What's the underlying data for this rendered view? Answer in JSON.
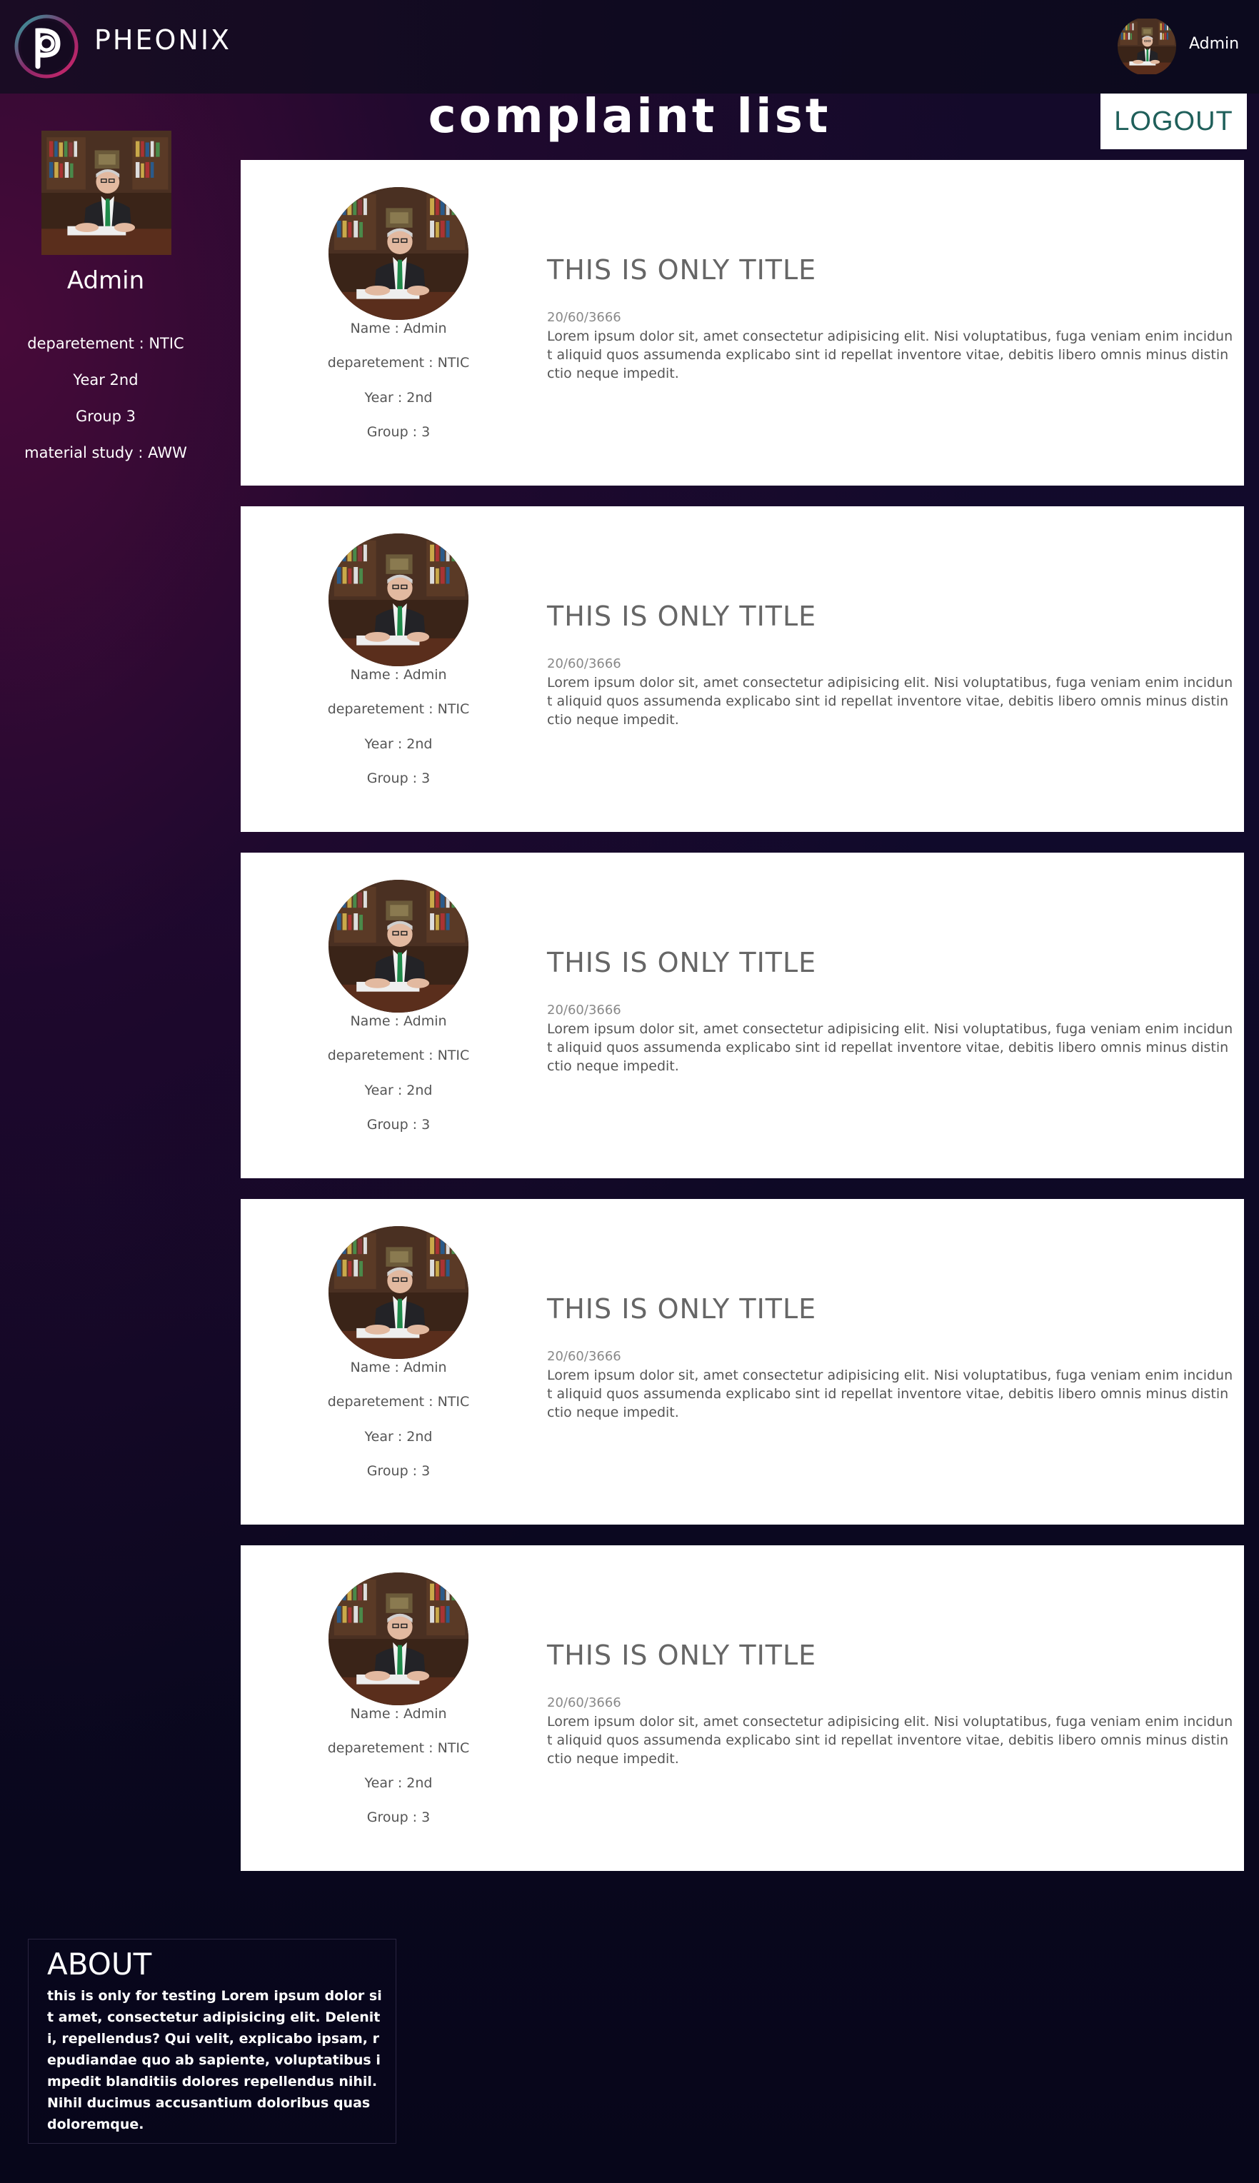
{
  "header": {
    "brand": "PHEONIX",
    "user_name": "Admin",
    "logout_label": "LOGOUT"
  },
  "page_title": "complaint list",
  "sidebar": {
    "name": "Admin",
    "lines": [
      "deparetement : NTIC",
      "Year 2nd",
      "Group 3",
      "material study : AWW"
    ]
  },
  "complaints": [
    {
      "name": "Name : Admin",
      "department": "deparetement : NTIC",
      "year": "Year : 2nd",
      "group": "Group : 3",
      "title": "THIS IS ONLY TITLE",
      "date": "20/60/3666",
      "body": "Lorem ipsum dolor sit, amet consectetur adipisicing elit. Nisi voluptatibus, fuga veniam enim incidunt aliquid quos assumenda explicabo sint id repellat inventore vitae, debitis libero omnis minus distinctio neque impedit."
    },
    {
      "name": "Name : Admin",
      "department": "deparetement : NTIC",
      "year": "Year : 2nd",
      "group": "Group : 3",
      "title": "THIS IS ONLY TITLE",
      "date": "20/60/3666",
      "body": "Lorem ipsum dolor sit, amet consectetur adipisicing elit. Nisi voluptatibus, fuga veniam enim incidunt aliquid quos assumenda explicabo sint id repellat inventore vitae, debitis libero omnis minus distinctio neque impedit."
    },
    {
      "name": "Name : Admin",
      "department": "deparetement : NTIC",
      "year": "Year : 2nd",
      "group": "Group : 3",
      "title": "THIS IS ONLY TITLE",
      "date": "20/60/3666",
      "body": "Lorem ipsum dolor sit, amet consectetur adipisicing elit. Nisi voluptatibus, fuga veniam enim incidunt aliquid quos assumenda explicabo sint id repellat inventore vitae, debitis libero omnis minus distinctio neque impedit."
    },
    {
      "name": "Name : Admin",
      "department": "deparetement : NTIC",
      "year": "Year : 2nd",
      "group": "Group : 3",
      "title": "THIS IS ONLY TITLE",
      "date": "20/60/3666",
      "body": "Lorem ipsum dolor sit, amet consectetur adipisicing elit. Nisi voluptatibus, fuga veniam enim incidunt aliquid quos assumenda explicabo sint id repellat inventore vitae, debitis libero omnis minus distinctio neque impedit."
    },
    {
      "name": "Name : Admin",
      "department": "deparetement : NTIC",
      "year": "Year : 2nd",
      "group": "Group : 3",
      "title": "THIS IS ONLY TITLE",
      "date": "20/60/3666",
      "body": "Lorem ipsum dolor sit, amet consectetur adipisicing elit. Nisi voluptatibus, fuga veniam enim incidunt aliquid quos assumenda explicabo sint id repellat inventore vitae, debitis libero omnis minus distinctio neque impedit."
    }
  ],
  "about": {
    "title": "ABOUT",
    "text": "this is only for testing Lorem ipsum dolor sit amet, consectetur adipisicing elit. Deleniti, repellendus? Qui velit, explicabo ipsam, repudiandae quo ab sapiente, voluptatibus impedit blanditiis dolores repellendus nihil. Nihil ducimus accusantium doloribus quas doloremque."
  }
}
